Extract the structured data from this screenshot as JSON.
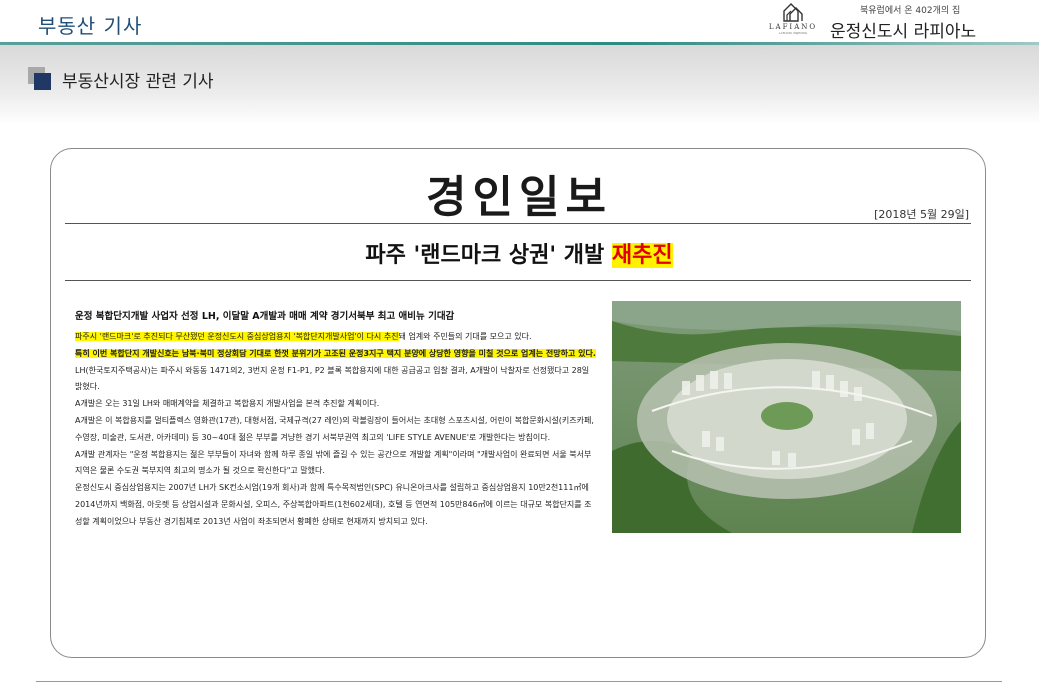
{
  "header": {
    "page_heading": "부동산 기사",
    "brand_tagline": "북유럽에서 온 402개의 집",
    "brand_name": "운정신도시 라피아노",
    "logo_text": "LAFIANO",
    "logo_sub": "LAFIANO UNJEONG",
    "logo_icon": "house-logo-icon"
  },
  "section": {
    "title": "부동산시장 관련 기사",
    "marker_icon": "square-bullet-icon"
  },
  "article": {
    "newspaper": "경인일보",
    "date": "[2018년 5월 29일]",
    "headline_prefix": "파주 '랜드마크 상권' 개발 ",
    "headline_highlight": "재추진",
    "lead": "운정 복합단지개발 사업자 선정 LH, 이달말 A개발과 매매 계약 경기서북부 최고 애비뉴 기대감",
    "hl_1": " 파주시 '랜드마크'로 추진되다 무산됐던 운정신도시 중심상업용지 '복합단지개발사업'이 다시 추진",
    "p1_rest": "돼 업계와 주민들의 기대를 모으고 있다.",
    "hl_2": "특히 이번 복합단지 개발신호는 남북·북미 정상회담 기대로 한껏 분위기가 고조된 운정3지구 택지 분양에 상당한 영향을 미칠 것으로 업계는 전망하고 있다.",
    "p3": "LH(한국토지주택공사)는 파주시 와동동 1471의2, 3번지 운정 F1-P1, P2 블록 복합용지에 대한 공급공고 입찰 결과, A개발이 낙찰자로 선정됐다고 28일 밝혔다.",
    "p4": "A개발은 오는 31일 LH와 매매계약을 체결하고 복합용지 개발사업을 본격 추진할 계획이다.",
    "p5": "A개발은 이 복합용지를 멀티플렉스 영화관(17관), 대형서점, 국제규격(27 레인)의 락볼링장이 들어서는 초대형 스포츠시설, 어린이 복합문화시설(키즈카페, 수영장, 미술관, 도서관, 아카데미) 등 30~40대 젊은 부부를 겨냥한 경기 서북부권역 최고의 'LIFE STYLE AVENUE'로 개발한다는 방침이다.",
    "p6": "A개발 관계자는 \"운정 복합용지는 젊은 부부들이 자녀와 함께 하루 종일 밖에 즐길 수 있는 공간으로 개발할 계획\"이라며 \"개발사업이 완료되면 서울 북서부지역은 물론 수도권 북부지역 최고의 명소가 될 것으로 확신한다\"고 말했다.",
    "p7": "운정신도시 중심상업용지는 2007년 LH가 SK컨소시엄(19개 회사)과 함께 특수목적법인(SPC) 유니온아크사를 설립하고 중심상업용지 10만2천111㎡에 2014년까지 백화점, 아웃렛 등 상업시설과 문화시설, 오피스, 주상복합아파트(1천602세대), 호텔 등 연면적 105만846㎡에 이르는 대규모 복합단지를 조성할 계획이었으나 부동산 경기침체로 2013년 사업이 좌초되면서 황폐한 상태로 현재까지 방치되고 있다.",
    "photo": "aerial-city-photo"
  }
}
